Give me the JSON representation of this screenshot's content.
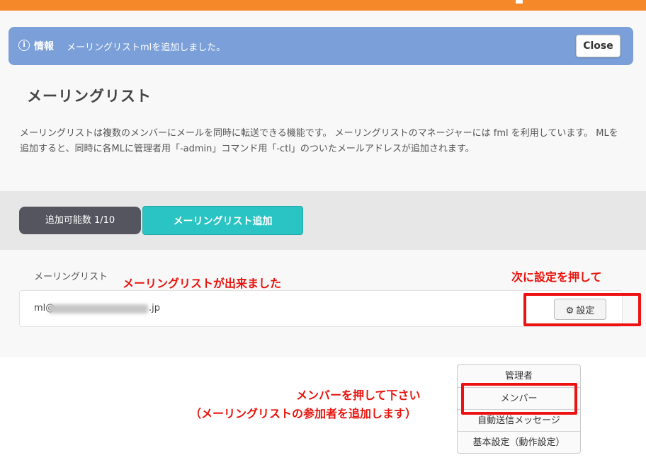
{
  "alert": {
    "label": "情報",
    "message": "メーリングリストmlを追加しました。",
    "close_label": "Close"
  },
  "page": {
    "title": "メーリングリスト",
    "description": "メーリングリストは複数のメンバーにメールを同時に転送できる機能です。 メーリングリストのマネージャーには fml を利用しています。 MLを追加すると、同時に各MLに管理者用「-admin」コマンド用「-ctl」のついたメールアドレスが追加されます。"
  },
  "actions": {
    "count_label": "追加可能数 1/10",
    "add_label": "メーリングリスト追加"
  },
  "list": {
    "header": "メーリングリスト",
    "rows": [
      {
        "email_prefix": "ml@",
        "email_suffix": ".jp",
        "settings_label": "設定"
      }
    ]
  },
  "dropdown": {
    "items": [
      "管理者",
      "メンバー",
      "自動送信メッセージ",
      "基本設定（動作設定）"
    ]
  },
  "annotations": {
    "created": "メーリングリストが出来ました",
    "next_settings": "次に設定を押して",
    "member_line1": "メンバーを押して下さい",
    "member_line2": "（メーリングリストの参加者を追加します）"
  },
  "colors": {
    "topbar": "#f5892a",
    "alert": "#7b9fd9",
    "add_button": "#2bc4c4",
    "count_badge": "#55555f",
    "annotation_red": "#e8120c"
  }
}
